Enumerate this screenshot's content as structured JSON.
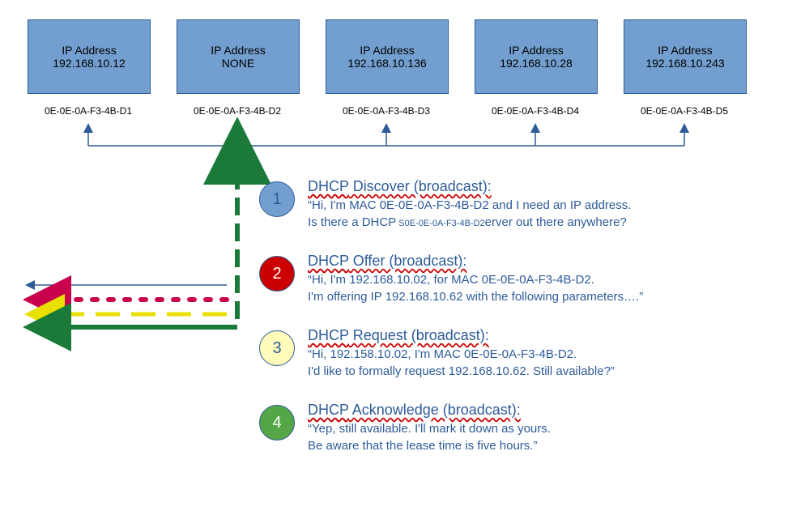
{
  "hosts": [
    {
      "ip_label": "IP Address",
      "ip": "192.168.10.12",
      "mac": "0E-0E-0A-F3-4B-D1"
    },
    {
      "ip_label": "IP Address",
      "ip": "NONE",
      "mac": "0E-0E-0A-F3-4B-D2"
    },
    {
      "ip_label": "IP Address",
      "ip": "192.168.10.136",
      "mac": "0E-0E-0A-F3-4B-D3"
    },
    {
      "ip_label": "IP Address",
      "ip": "192.168.10.28",
      "mac": "0E-0E-0A-F3-4B-D4"
    },
    {
      "ip_label": "IP Address",
      "ip": "192.168.10.243",
      "mac": "0E-0E-0A-F3-4B-D5"
    }
  ],
  "steps": [
    {
      "num": "1",
      "color": "blue",
      "title_prefix": "DHCP",
      "title_rest": " Discover (broadcast):",
      "line1": "“Hi, I'm MAC 0E-0E-0A-F3-4B-D2 and I need an IP address.",
      "line2_pre": "Is there a ",
      "line2_und": "DHCP",
      "line2_small": " S0E-0E-0A-F3-4B-D2",
      "line2_post": "erver out there anywhere?"
    },
    {
      "num": "2",
      "color": "red",
      "title_prefix": "DHCP",
      "title_rest": " Offer (broadcast):",
      "line1": "“Hi, I'm 192.168.10.02, for MAC 0E-0E-0A-F3-4B-D2.",
      "line2": "I'm offering IP 192.168.10.62 with the following parameters….”"
    },
    {
      "num": "3",
      "color": "yellow",
      "title_prefix": "DHCP",
      "title_rest": " Request (broadcast):",
      "line1": "“Hi, 192.158.10.02, I'm MAC 0E-0E-0A-F3-4B-D2.",
      "line2": "I'd like to formally request 192.168.10.62.  Still available?”"
    },
    {
      "num": "4",
      "color": "green",
      "title_prefix": "DHCP",
      "title_rest": " Acknowledge (broadcast):",
      "line1": "“Yep, still available.  I'll mark it down as yours.",
      "line2": "Be aware that the lease time is five hours.”"
    }
  ],
  "colors": {
    "arrow": "#2e5b99",
    "green": "#1b7a3a",
    "red": "#c9004b",
    "yellow": "#e8e100"
  }
}
